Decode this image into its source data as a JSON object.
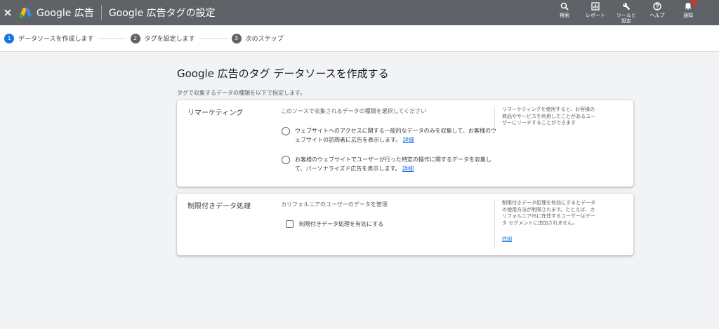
{
  "topbar": {
    "brand": "Google 広告",
    "page_title": "Google 広告タグの設定",
    "actions": [
      {
        "icon": "search-icon",
        "label": "検索"
      },
      {
        "icon": "reports-icon",
        "label": "レポート"
      },
      {
        "icon": "wrench-icon",
        "label": "ツールと\n設定"
      },
      {
        "icon": "help-icon",
        "label": "ヘルプ"
      },
      {
        "icon": "bell-icon",
        "label": "通知"
      }
    ]
  },
  "stepper": {
    "steps": [
      {
        "num": "1",
        "label": "データソースを作成します"
      },
      {
        "num": "2",
        "label": "タグを設定します"
      },
      {
        "num": "3",
        "label": "次のステップ"
      }
    ]
  },
  "main": {
    "title": "Google 広告のタグ データソースを作成する",
    "subtitle": "タグで収集するデータの種類を以下で指定します。"
  },
  "remarketing": {
    "title": "リマーケティング",
    "description": "このソースで収集されるデータの種類を選択してください",
    "options": [
      {
        "text": "ウェブサイトへのアクセスに関する一般的なデータのみを収集して、お客様のウェブサイトの訪問者に広告を表示します。",
        "link": "詳細"
      },
      {
        "text": "お客様のウェブサイトでユーザーが行った特定の操作に関するデータを収集して、パーソナライズド広告を表示します。",
        "link": "詳細"
      }
    ],
    "side_note": "リマーケティングを使用すると、お客様の商品やサービスを利用したことがあるユーザーにリーチすることができます"
  },
  "restricted": {
    "title": "制限付きデータ処理",
    "description": "カリフォルニアのユーザーのデータを管理",
    "checkbox_label": "制限付きデータ処理を有効にする",
    "side_note": "制限付きデータ処理を有効にするとデータの使用方法が制限されます。たとえば、カリフォルニア州に在住するユーザーはデータ セグメントに追加されません。",
    "side_link": "詳細"
  }
}
